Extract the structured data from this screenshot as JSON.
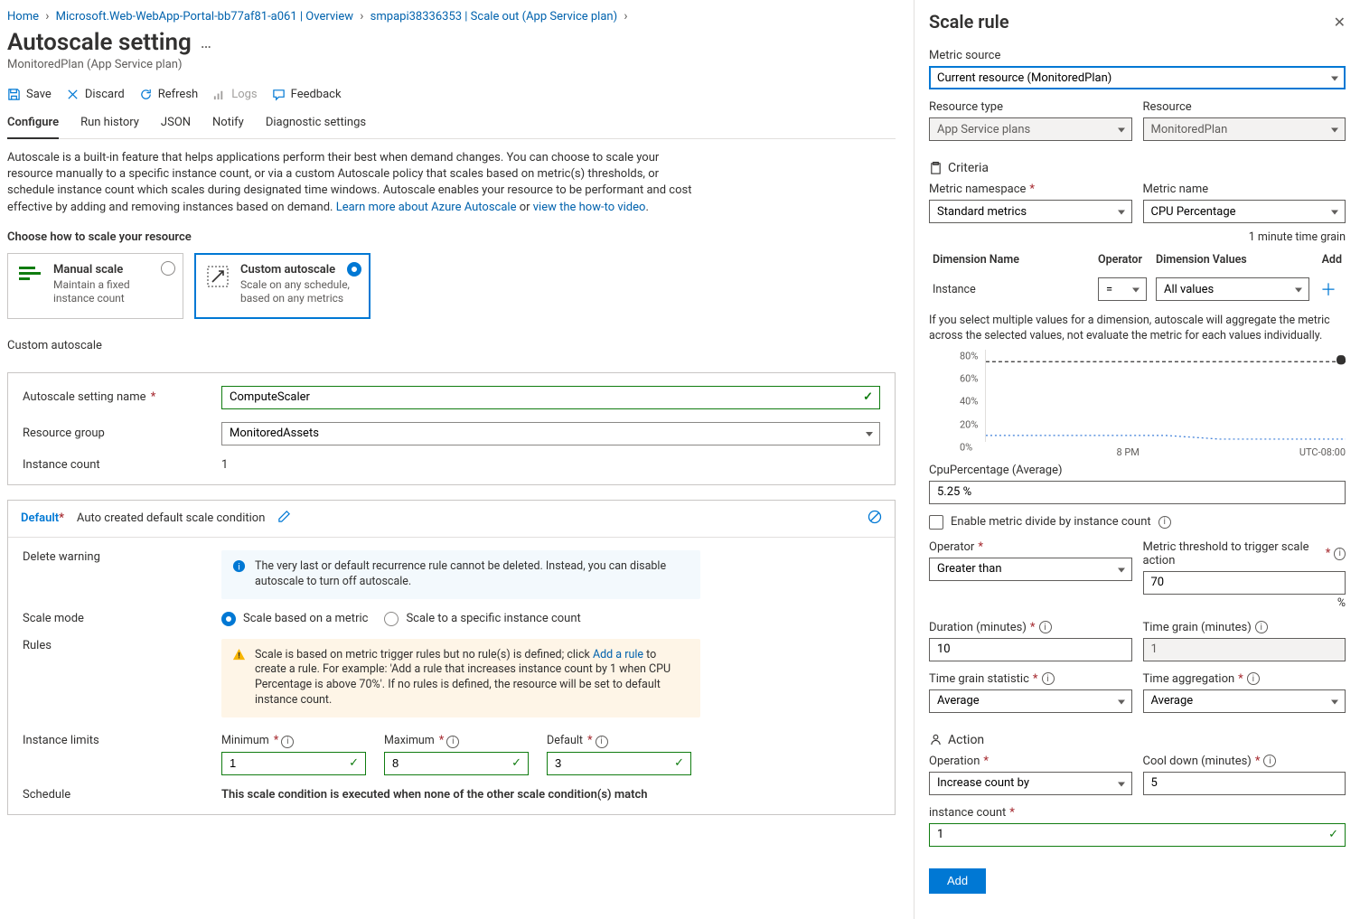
{
  "breadcrumb": {
    "home": "Home",
    "webapp": "Microsoft.Web-WebApp-Portal-bb77af81-a061 | Overview",
    "smp": "smpapi38336353 | Scale out (App Service plan)"
  },
  "page": {
    "title": "Autoscale setting",
    "subtitle": "MonitoredPlan (App Service plan)"
  },
  "toolbar": {
    "save": "Save",
    "discard": "Discard",
    "refresh": "Refresh",
    "logs": "Logs",
    "feedback": "Feedback"
  },
  "tabs": {
    "configure": "Configure",
    "run_history": "Run history",
    "json": "JSON",
    "notify": "Notify",
    "diagnostic": "Diagnostic settings"
  },
  "intro": {
    "text": "Autoscale is a built-in feature that helps applications perform their best when demand changes. You can choose to scale your resource manually to a specific instance count, or via a custom Autoscale policy that scales based on metric(s) thresholds, or schedule instance count which scales during designated time windows. Autoscale enables your resource to be performant and cost effective by adding and removing instances based on demand.",
    "learn": "Learn more about Azure Autoscale",
    "or": " or ",
    "video": "view the how-to video",
    "choose": "Choose how to scale your resource"
  },
  "cards": {
    "manual_title": "Manual scale",
    "manual_desc": "Maintain a fixed instance count",
    "custom_title": "Custom autoscale",
    "custom_desc": "Scale on any schedule, based on any metrics"
  },
  "form": {
    "heading": "Custom autoscale",
    "name_label": "Autoscale setting name",
    "name_value": "ComputeScaler",
    "rg_label": "Resource group",
    "rg_value": "MonitoredAssets",
    "instance_label": "Instance count",
    "instance_value": "1"
  },
  "condition": {
    "title": "Default",
    "subtitle": "Auto created default scale condition",
    "delete_label": "Delete warning",
    "delete_msg": "The very last or default recurrence rule cannot be deleted. Instead, you can disable autoscale to turn off autoscale.",
    "scale_mode_label": "Scale mode",
    "scale_metric": "Scale based on a metric",
    "scale_specific": "Scale to a specific instance count",
    "rules_label": "Rules",
    "rules_msg_pre": "Scale is based on metric trigger rules but no rule(s) is defined; click ",
    "rules_link": "Add a rule",
    "rules_msg_post": " to create a rule. For example: 'Add a rule that increases instance count by 1 when CPU Percentage is above 70%'. If no rules is defined, the resource will be set to default instance count.",
    "limits_label": "Instance limits",
    "min": "Minimum",
    "min_val": "1",
    "max": "Maximum",
    "max_val": "8",
    "def": "Default",
    "def_val": "3",
    "schedule_label": "Schedule",
    "schedule_msg": "This scale condition is executed when none of the other scale condition(s) match"
  },
  "panel": {
    "title": "Scale rule",
    "metric_source_label": "Metric source",
    "metric_source_value": "Current resource (MonitoredPlan)",
    "resource_type_label": "Resource type",
    "resource_type_value": "App Service plans",
    "resource_label": "Resource",
    "resource_value": "MonitoredPlan",
    "criteria": "Criteria",
    "metric_ns_label": "Metric namespace",
    "metric_ns_value": "Standard metrics",
    "metric_name_label": "Metric name",
    "metric_name_value": "CPU Percentage",
    "time_grain_note": "1 minute time grain",
    "dim_name": "Dimension Name",
    "dim_op": "Operator",
    "dim_values": "Dimension Values",
    "dim_add": "Add",
    "instance_label": "Instance",
    "op_eq": "=",
    "all_values": "All values",
    "dim_note": "If you select multiple values for a dimension, autoscale will aggregate the metric across the selected values, not evaluate the metric for each values individually.",
    "y80": "80%",
    "y60": "60%",
    "y40": "40%",
    "y20": "20%",
    "y0": "0%",
    "x8pm": "8 PM",
    "tz": "UTC-08:00",
    "avg_label": "CpuPercentage (Average)",
    "avg_value": "5.25 %",
    "enable_divide": "Enable metric divide by instance count",
    "operator_label": "Operator",
    "operator_value": "Greater than",
    "threshold_label": "Metric threshold to trigger scale action",
    "threshold_value": "70",
    "pct": "%",
    "duration_label": "Duration (minutes)",
    "duration_value": "10",
    "grain_label": "Time grain (minutes)",
    "grain_value": "1",
    "stat_label": "Time grain statistic",
    "stat_value": "Average",
    "agg_label": "Time aggregation",
    "agg_value": "Average",
    "action": "Action",
    "operation_label": "Operation",
    "operation_value": "Increase count by",
    "cooldown_label": "Cool down (minutes)",
    "cooldown_value": "5",
    "inst_count_label": "instance count",
    "inst_count_value": "1",
    "add_button": "Add"
  },
  "chart_data": {
    "type": "line",
    "title": "CpuPercentage (Average)",
    "ylabel": "%",
    "ylim": [
      0,
      80
    ],
    "y_ticks": [
      0,
      20,
      40,
      60,
      80
    ],
    "threshold": 70,
    "timezone": "UTC-08:00",
    "x_tick_label": "8 PM",
    "series": [
      {
        "name": "CpuPercentage",
        "approx_value_percent": 5.25
      }
    ]
  }
}
